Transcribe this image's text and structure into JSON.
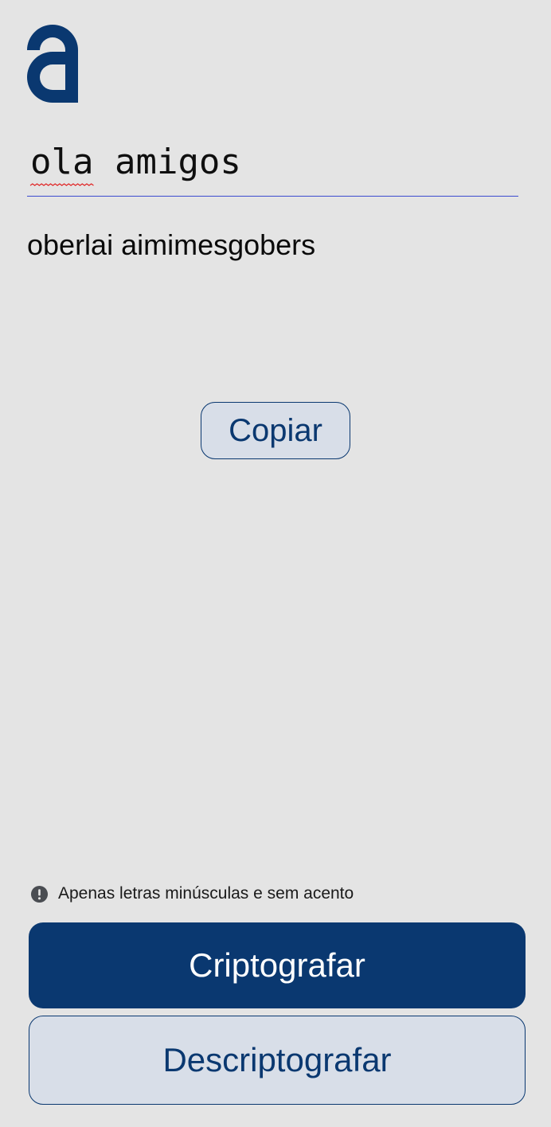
{
  "logo": {
    "icon": "alura-a-logo-icon",
    "color": "#0a3870"
  },
  "input": {
    "value_part1": "ola",
    "value_part2": " amigos",
    "underline_color": "#3b4bd0",
    "spellcheck_color": "#e02020"
  },
  "output": {
    "text": "oberlai aimimesgobers"
  },
  "copy_button": {
    "label": "Copiar"
  },
  "info": {
    "icon": "exclamation-circle-icon",
    "text": "Apenas letras minúsculas e sem acento"
  },
  "encrypt_button": {
    "label": "Criptografar"
  },
  "decrypt_button": {
    "label": "Descriptografar"
  },
  "colors": {
    "background": "#e4e4e4",
    "primary": "#0a3870",
    "secondary_bg": "#d8dee8"
  }
}
